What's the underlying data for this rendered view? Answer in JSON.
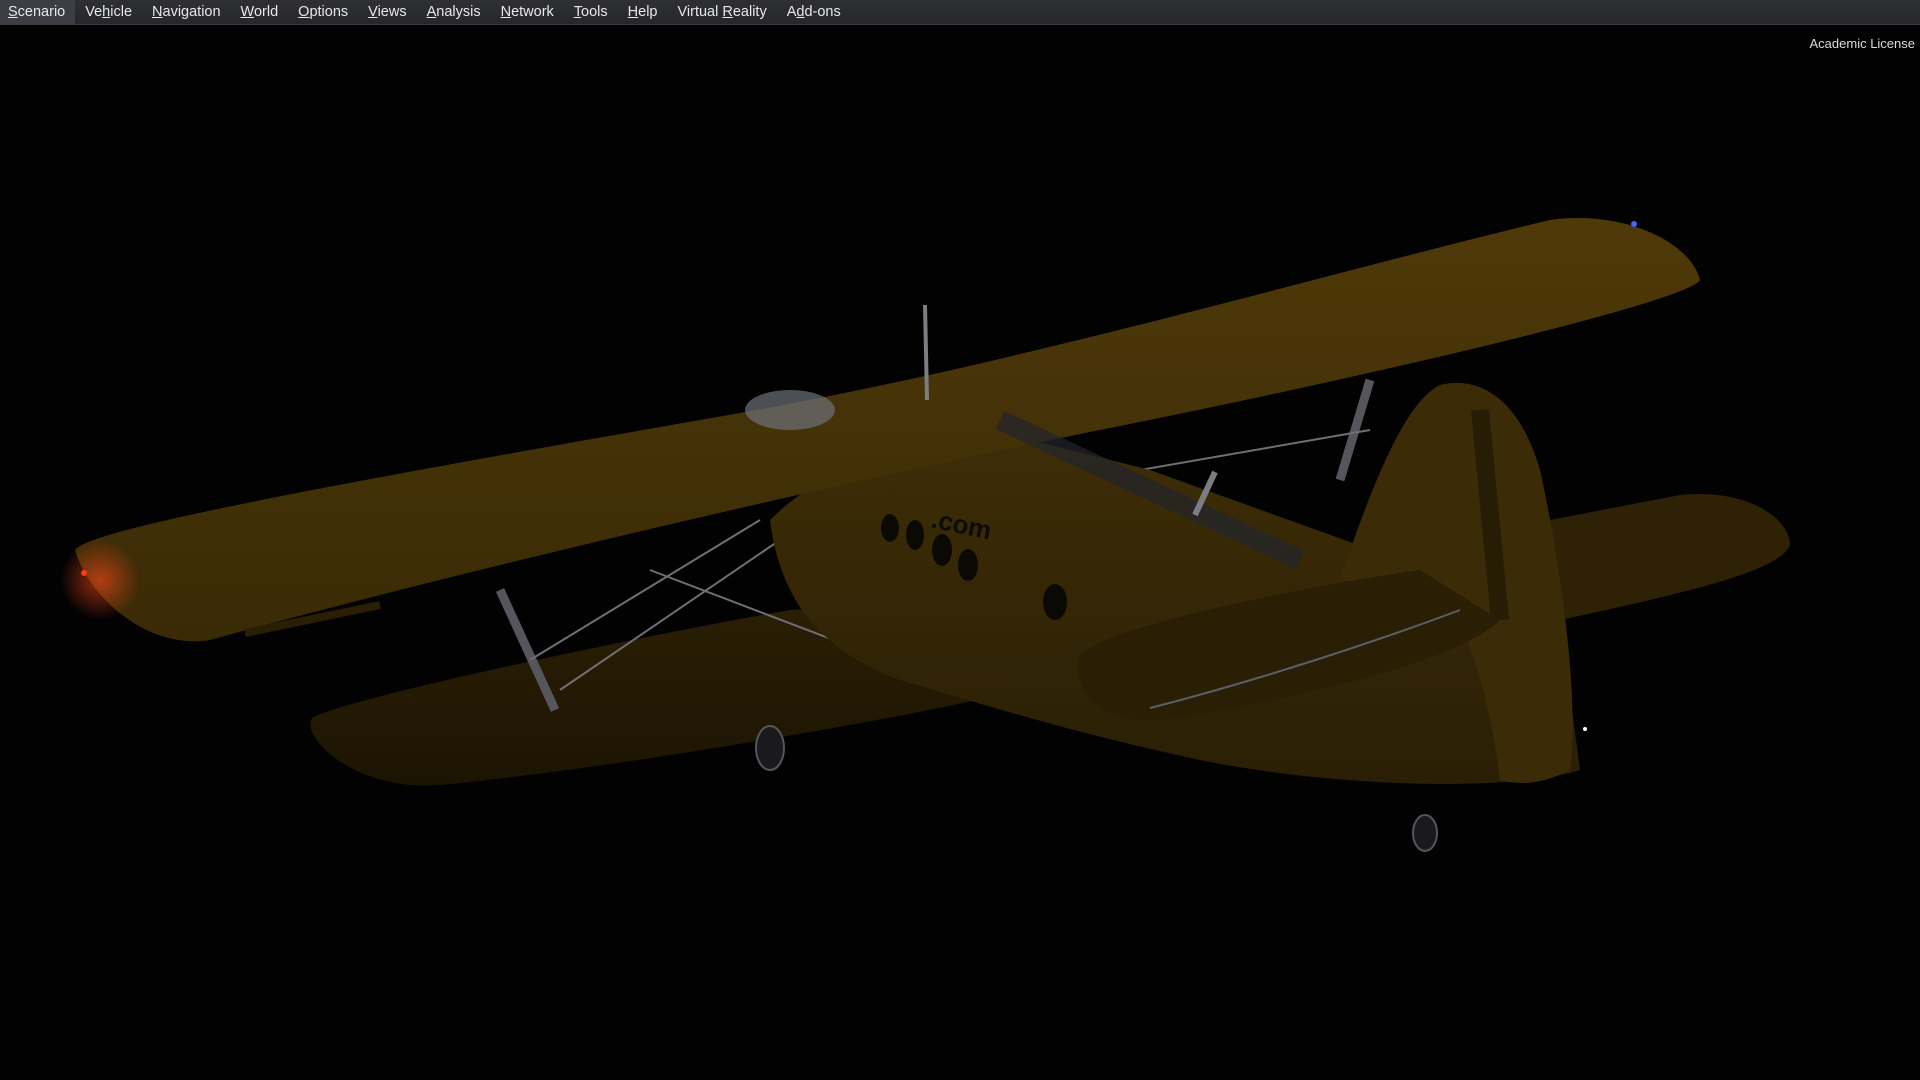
{
  "menubar": {
    "items": [
      {
        "label": "Scenario",
        "mnemonic": "S"
      },
      {
        "label": "Vehicle",
        "mnemonic": "h"
      },
      {
        "label": "Navigation",
        "mnemonic": "N"
      },
      {
        "label": "World",
        "mnemonic": "W"
      },
      {
        "label": "Options",
        "mnemonic": "O"
      },
      {
        "label": "Views",
        "mnemonic": "V"
      },
      {
        "label": "Analysis",
        "mnemonic": "A"
      },
      {
        "label": "Network",
        "mnemonic": "N"
      },
      {
        "label": "Tools",
        "mnemonic": "T"
      },
      {
        "label": "Help",
        "mnemonic": "H"
      },
      {
        "label": "Virtual Reality",
        "mnemonic": "R"
      },
      {
        "label": "Add-ons",
        "mnemonic": "d"
      }
    ]
  },
  "overlay": {
    "license_text": "Academic License"
  },
  "scene": {
    "aircraft_livery_text": ".com",
    "colors": {
      "sky": "#020203",
      "fuselage": "#3a2a06",
      "wing_top": "#4a3508",
      "wing_shadow": "#2a1e05",
      "nav_light_red": "#ff3a1a",
      "nav_light_blue": "#3a6aff",
      "strut": "#8a8a90"
    }
  }
}
